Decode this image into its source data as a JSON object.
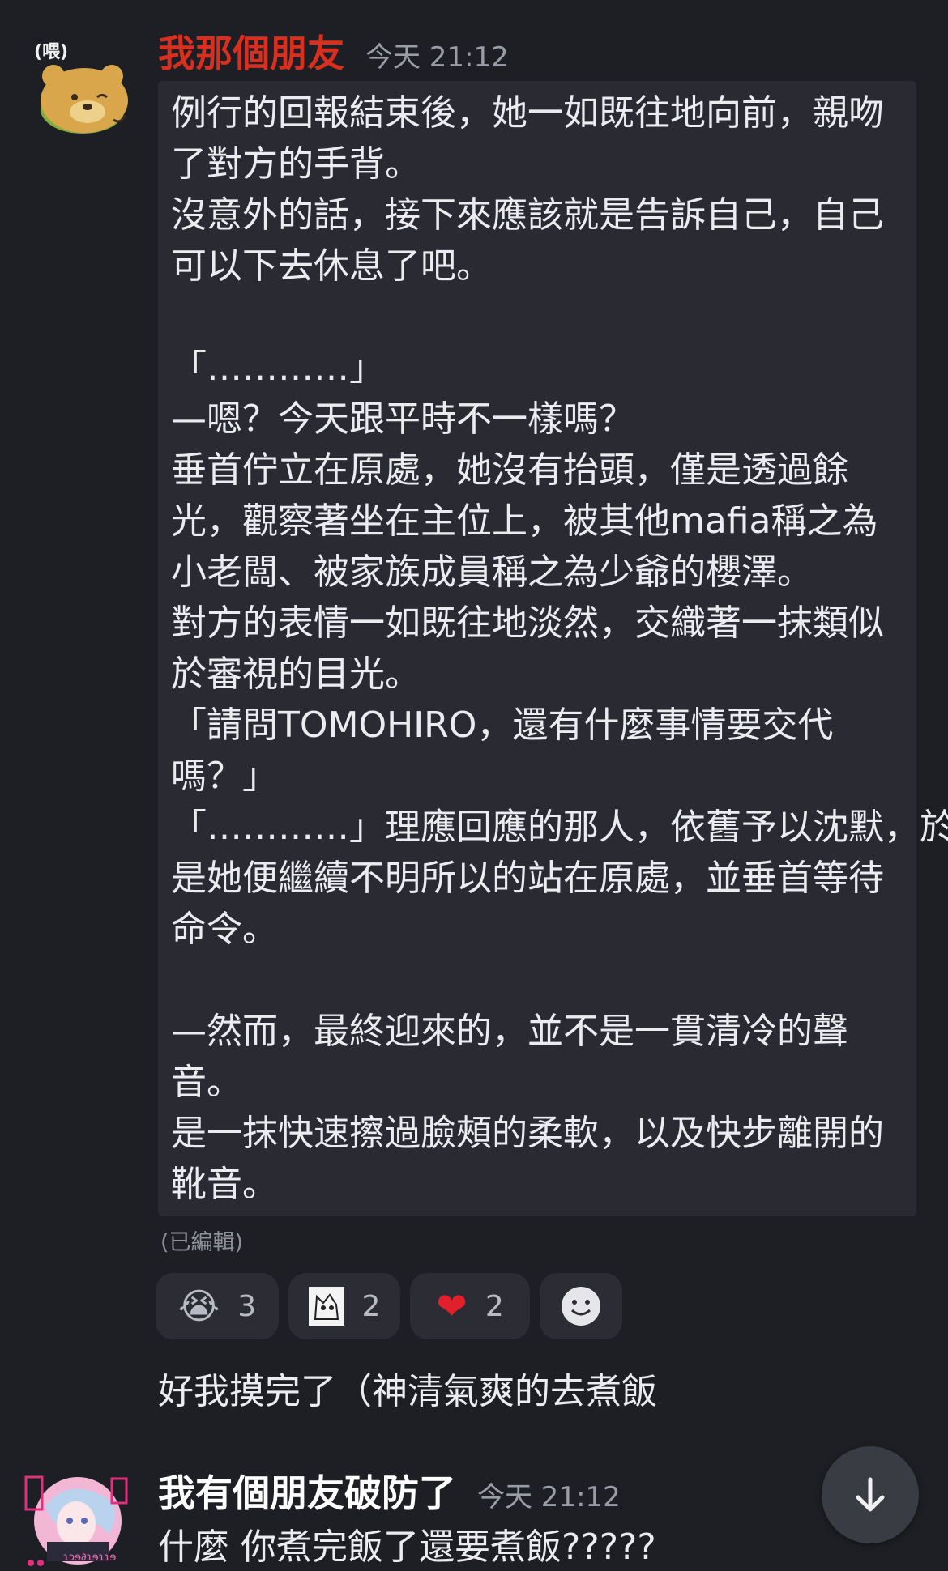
{
  "messages": [
    {
      "author": "我那個朋友",
      "author_color": "#d92f1f",
      "timestamp": "今天 21:12",
      "avatar": "bear-avatar",
      "avatar_text": "(喂)",
      "quote_lines": [
        "例行的回報結束後，她一如既往地向前，親吻",
        "了對方的手背。",
        "沒意外的話，接下來應該就是告訴自己，自己",
        "可以下去休息了吧。",
        "",
        "「…………」",
        "—嗯？今天跟平時不一樣嗎？",
        "垂首佇立在原處，她沒有抬頭，僅是透過餘",
        "光，觀察著坐在主位上，被其他mafia稱之為",
        "小老闆、被家族成員稱之為少爺的櫻澤。",
        "對方的表情一如既往地淡然，交織著一抹類似",
        "於審視的目光。",
        "「請問TOMOHIRO，還有什麼事情要交代",
        "嗎？」",
        "「…………」理應回應的那人，依舊予以沈默，於",
        "是她便繼續不明所以的站在原處，並垂首等待",
        "命令。",
        "",
        "—然而，最終迎來的，並不是一貫清冷的聲",
        "音。",
        "是一抹快速擦過臉頰的柔軟，以及快步離開的",
        "靴音。"
      ],
      "edited_label": "(已編輯)",
      "reactions": [
        {
          "icon": "crying-face-icon",
          "glyph": "😭",
          "count": "3"
        },
        {
          "icon": "custom-sticker-icon",
          "glyph": "",
          "count": "2"
        },
        {
          "icon": "red-heart-icon",
          "glyph": "❤",
          "count": "2"
        },
        {
          "icon": "add-reaction-icon",
          "glyph": "",
          "count": ""
        }
      ],
      "followup": "好我摸完了（神清氣爽的去煮飯"
    },
    {
      "author": "我有個朋友破防了",
      "author_color": "#ffffff",
      "timestamp": "今天 21:12",
      "avatar": "anime-avatar",
      "avatar_caption": "ɿɔɘ∂ɿɘɿɿɘ",
      "text": "什麼 你煮完飯了還要煮飯?????"
    }
  ],
  "scroll_button_icon": "arrow-down-icon"
}
